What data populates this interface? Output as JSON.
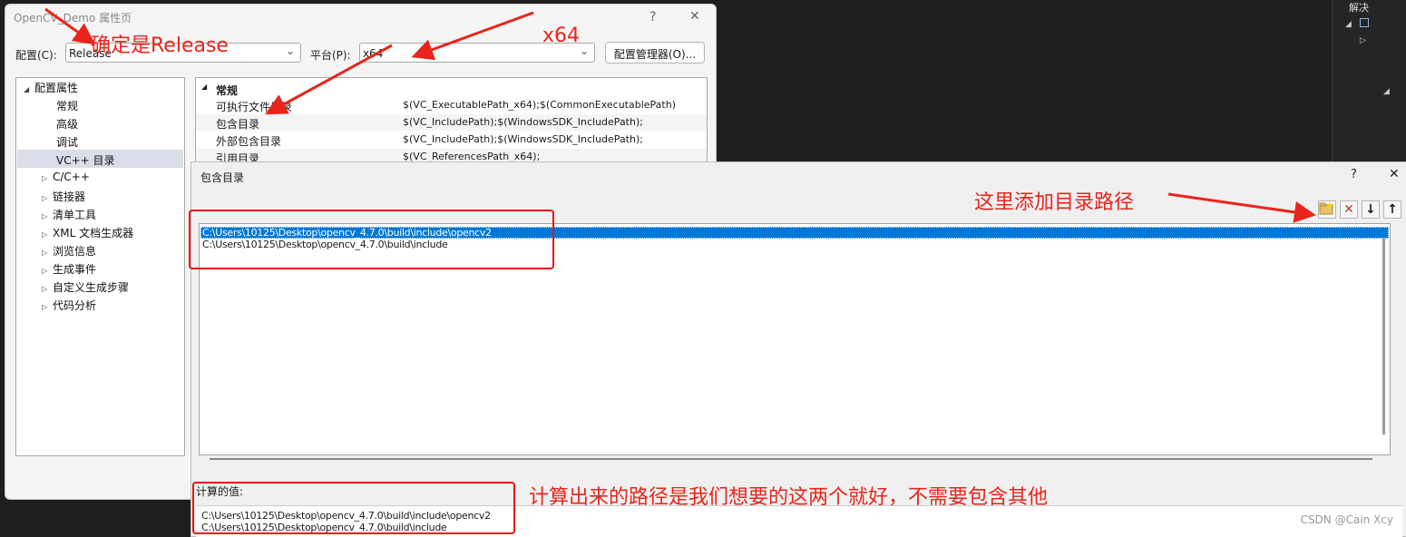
{
  "prop_window": {
    "title": "OpenCV_Demo 属性页",
    "help": "?",
    "close": "✕",
    "config_label": "配置(C):",
    "config_value": "Release",
    "platform_label": "平台(P):",
    "platform_value": "x64",
    "config_manager": "配置管理器(O)...",
    "tree": [
      {
        "label": "配置属性",
        "tw": "◢"
      },
      {
        "label": "常规",
        "tw": ""
      },
      {
        "label": "高级",
        "tw": ""
      },
      {
        "label": "调试",
        "tw": ""
      },
      {
        "label": "VC++ 目录",
        "tw": ""
      },
      {
        "label": "C/C++",
        "tw": "▷"
      },
      {
        "label": "链接器",
        "tw": "▷"
      },
      {
        "label": "清单工具",
        "tw": "▷"
      },
      {
        "label": "XML 文档生成器",
        "tw": "▷"
      },
      {
        "label": "浏览信息",
        "tw": "▷"
      },
      {
        "label": "生成事件",
        "tw": "▷"
      },
      {
        "label": "自定义生成步骤",
        "tw": "▷"
      },
      {
        "label": "代码分析",
        "tw": "▷"
      }
    ],
    "grid_section": "常规",
    "grid_rows": [
      {
        "k": "可执行文件目录",
        "v": "$(VC_ExecutablePath_x64);$(CommonExecutablePath)"
      },
      {
        "k": "包含目录",
        "v": "$(VC_IncludePath);$(WindowsSDK_IncludePath);"
      },
      {
        "k": "外部包含目录",
        "v": "$(VC_IncludePath);$(WindowsSDK_IncludePath);"
      },
      {
        "k": "引用目录",
        "v": "$(VC_ReferencesPath_x64);"
      }
    ]
  },
  "include_dialog": {
    "title": "包含目录",
    "help": "?",
    "close": "✕",
    "entries": [
      "C:\\Users\\10125\\Desktop\\opencv_4.7.0\\build\\include\\opencv2",
      "C:\\Users\\10125\\Desktop\\opencv_4.7.0\\build\\include"
    ],
    "calc_label": "计算的值:",
    "calc_values": [
      "C:\\Users\\10125\\Desktop\\opencv_4.7.0\\build\\include\\opencv2",
      "C:\\Users\\10125\\Desktop\\opencv_4.7.0\\build\\include"
    ]
  },
  "annotations": {
    "release": "确定是Release",
    "x64": "x64",
    "add_path": "这里添加目录路径",
    "computed": "计算出来的路径是我们想要的这两个就好，不需要包含其他"
  },
  "ide": {
    "solution": "解决"
  },
  "watermark": "CSDN @Cain Xcy",
  "colors": {
    "annotation": "#e8251a",
    "selection": "#0078d7"
  }
}
